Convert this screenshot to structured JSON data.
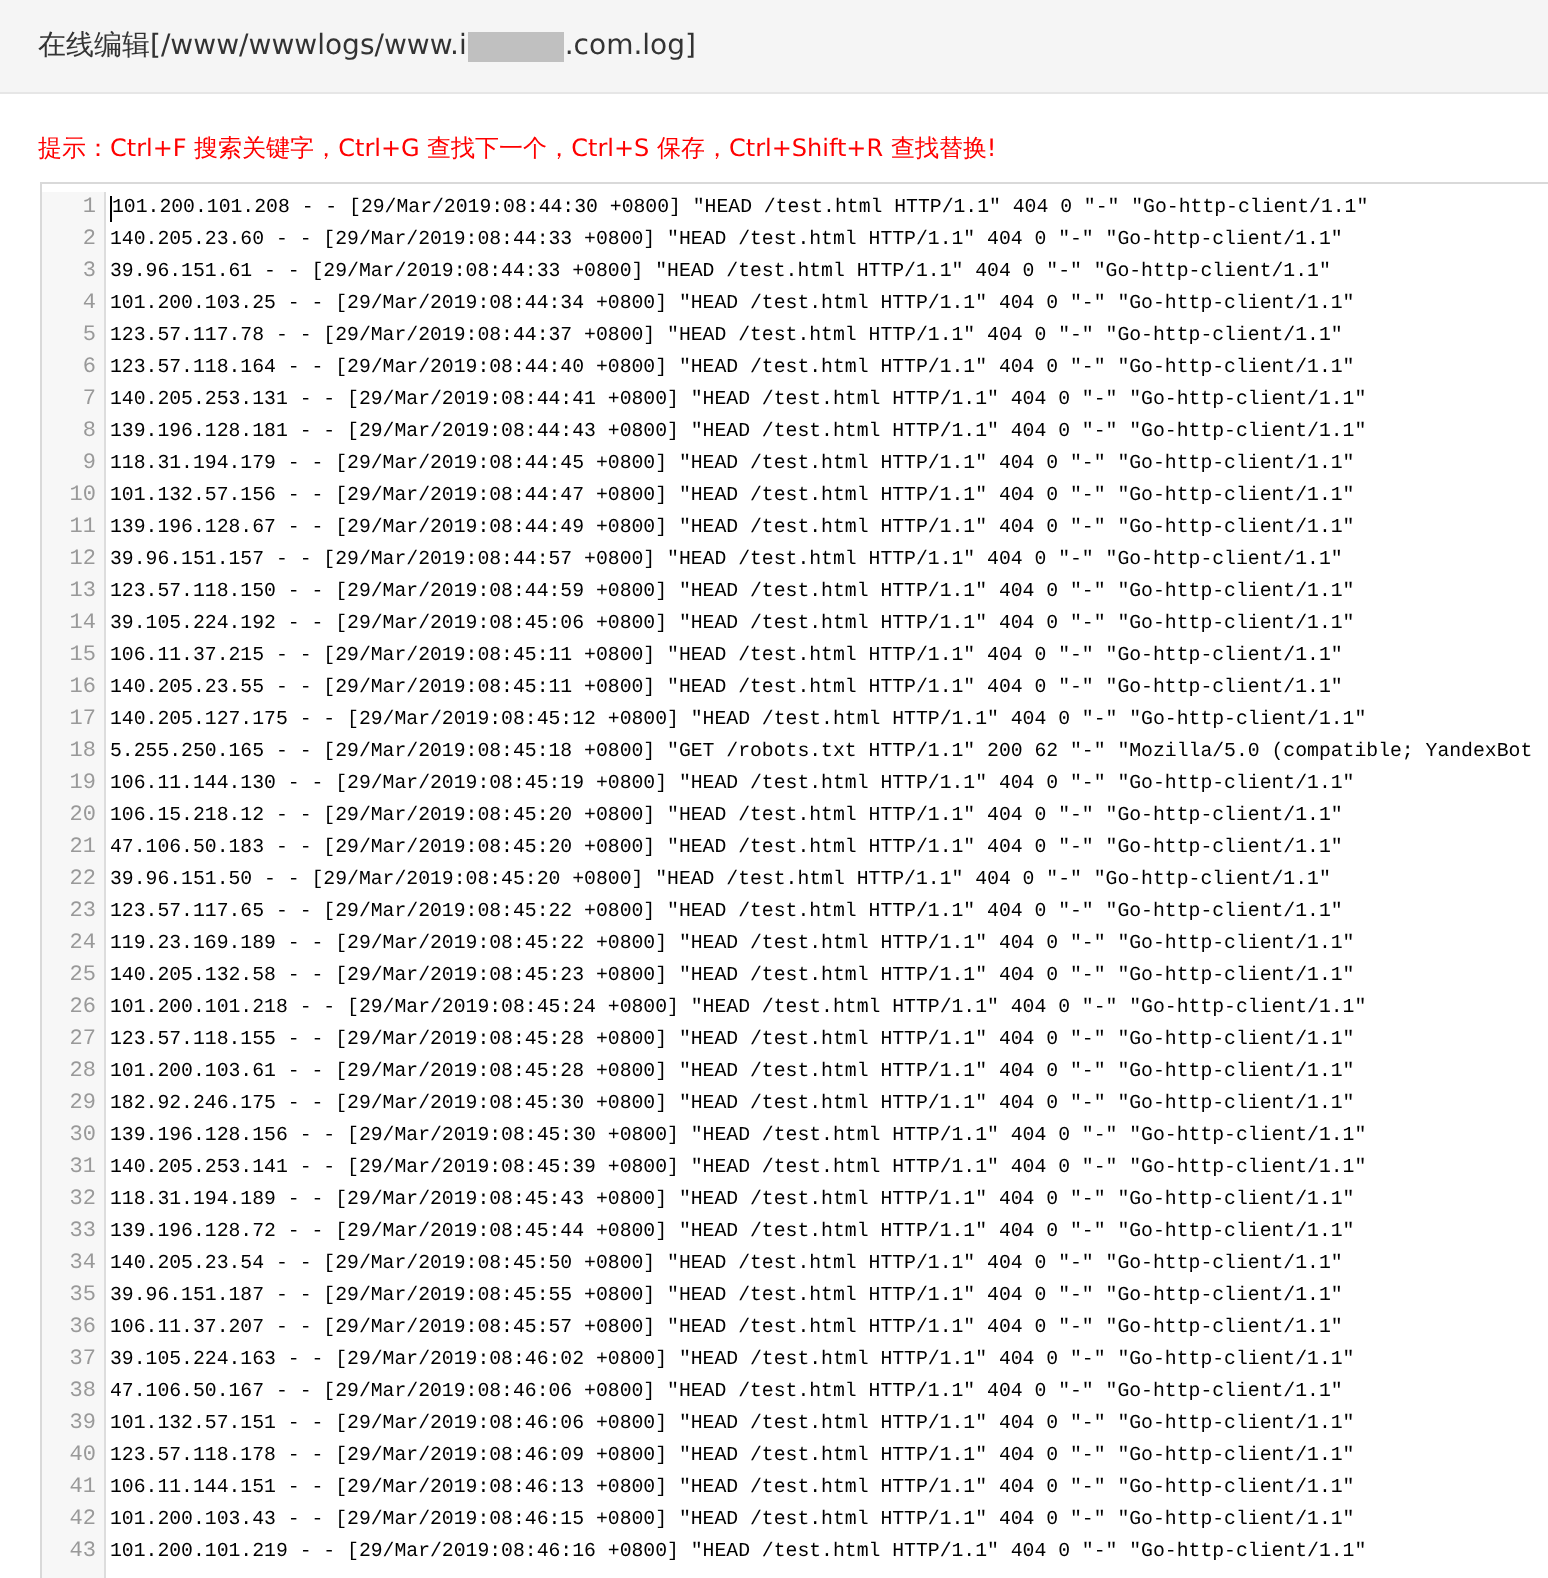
{
  "header": {
    "title_start": "在线编辑[/www/wwwlogs/www.i",
    "title_end": ".com.log]"
  },
  "hint": "提示：Ctrl+F 搜索关键字，Ctrl+G 查找下一个，Ctrl+S 保存，Ctrl+Shift+R 查找替换!",
  "editor": {
    "lines": [
      {
        "number": "1",
        "text": "101.200.101.208 - - [29/Mar/2019:08:44:30 +0800] \"HEAD /test.html HTTP/1.1\" 404 0 \"-\" \"Go-http-client/1.1\""
      },
      {
        "number": "2",
        "text": "140.205.23.60 - - [29/Mar/2019:08:44:33 +0800] \"HEAD /test.html HTTP/1.1\" 404 0 \"-\" \"Go-http-client/1.1\""
      },
      {
        "number": "3",
        "text": "39.96.151.61 - - [29/Mar/2019:08:44:33 +0800] \"HEAD /test.html HTTP/1.1\" 404 0 \"-\" \"Go-http-client/1.1\""
      },
      {
        "number": "4",
        "text": "101.200.103.25 - - [29/Mar/2019:08:44:34 +0800] \"HEAD /test.html HTTP/1.1\" 404 0 \"-\" \"Go-http-client/1.1\""
      },
      {
        "number": "5",
        "text": "123.57.117.78 - - [29/Mar/2019:08:44:37 +0800] \"HEAD /test.html HTTP/1.1\" 404 0 \"-\" \"Go-http-client/1.1\""
      },
      {
        "number": "6",
        "text": "123.57.118.164 - - [29/Mar/2019:08:44:40 +0800] \"HEAD /test.html HTTP/1.1\" 404 0 \"-\" \"Go-http-client/1.1\""
      },
      {
        "number": "7",
        "text": "140.205.253.131 - - [29/Mar/2019:08:44:41 +0800] \"HEAD /test.html HTTP/1.1\" 404 0 \"-\" \"Go-http-client/1.1\""
      },
      {
        "number": "8",
        "text": "139.196.128.181 - - [29/Mar/2019:08:44:43 +0800] \"HEAD /test.html HTTP/1.1\" 404 0 \"-\" \"Go-http-client/1.1\""
      },
      {
        "number": "9",
        "text": "118.31.194.179 - - [29/Mar/2019:08:44:45 +0800] \"HEAD /test.html HTTP/1.1\" 404 0 \"-\" \"Go-http-client/1.1\""
      },
      {
        "number": "10",
        "text": "101.132.57.156 - - [29/Mar/2019:08:44:47 +0800] \"HEAD /test.html HTTP/1.1\" 404 0 \"-\" \"Go-http-client/1.1\""
      },
      {
        "number": "11",
        "text": "139.196.128.67 - - [29/Mar/2019:08:44:49 +0800] \"HEAD /test.html HTTP/1.1\" 404 0 \"-\" \"Go-http-client/1.1\""
      },
      {
        "number": "12",
        "text": "39.96.151.157 - - [29/Mar/2019:08:44:57 +0800] \"HEAD /test.html HTTP/1.1\" 404 0 \"-\" \"Go-http-client/1.1\""
      },
      {
        "number": "13",
        "text": "123.57.118.150 - - [29/Mar/2019:08:44:59 +0800] \"HEAD /test.html HTTP/1.1\" 404 0 \"-\" \"Go-http-client/1.1\""
      },
      {
        "number": "14",
        "text": "39.105.224.192 - - [29/Mar/2019:08:45:06 +0800] \"HEAD /test.html HTTP/1.1\" 404 0 \"-\" \"Go-http-client/1.1\""
      },
      {
        "number": "15",
        "text": "106.11.37.215 - - [29/Mar/2019:08:45:11 +0800] \"HEAD /test.html HTTP/1.1\" 404 0 \"-\" \"Go-http-client/1.1\""
      },
      {
        "number": "16",
        "text": "140.205.23.55 - - [29/Mar/2019:08:45:11 +0800] \"HEAD /test.html HTTP/1.1\" 404 0 \"-\" \"Go-http-client/1.1\""
      },
      {
        "number": "17",
        "text": "140.205.127.175 - - [29/Mar/2019:08:45:12 +0800] \"HEAD /test.html HTTP/1.1\" 404 0 \"-\" \"Go-http-client/1.1\""
      },
      {
        "number": "18",
        "text": "5.255.250.165 - - [29/Mar/2019:08:45:18 +0800] \"GET /robots.txt HTTP/1.1\" 200 62 \"-\" \"Mozilla/5.0 (compatible; YandexBot"
      },
      {
        "number": "19",
        "text": "106.11.144.130 - - [29/Mar/2019:08:45:19 +0800] \"HEAD /test.html HTTP/1.1\" 404 0 \"-\" \"Go-http-client/1.1\""
      },
      {
        "number": "20",
        "text": "106.15.218.12 - - [29/Mar/2019:08:45:20 +0800] \"HEAD /test.html HTTP/1.1\" 404 0 \"-\" \"Go-http-client/1.1\""
      },
      {
        "number": "21",
        "text": "47.106.50.183 - - [29/Mar/2019:08:45:20 +0800] \"HEAD /test.html HTTP/1.1\" 404 0 \"-\" \"Go-http-client/1.1\""
      },
      {
        "number": "22",
        "text": "39.96.151.50 - - [29/Mar/2019:08:45:20 +0800] \"HEAD /test.html HTTP/1.1\" 404 0 \"-\" \"Go-http-client/1.1\""
      },
      {
        "number": "23",
        "text": "123.57.117.65 - - [29/Mar/2019:08:45:22 +0800] \"HEAD /test.html HTTP/1.1\" 404 0 \"-\" \"Go-http-client/1.1\""
      },
      {
        "number": "24",
        "text": "119.23.169.189 - - [29/Mar/2019:08:45:22 +0800] \"HEAD /test.html HTTP/1.1\" 404 0 \"-\" \"Go-http-client/1.1\""
      },
      {
        "number": "25",
        "text": "140.205.132.58 - - [29/Mar/2019:08:45:23 +0800] \"HEAD /test.html HTTP/1.1\" 404 0 \"-\" \"Go-http-client/1.1\""
      },
      {
        "number": "26",
        "text": "101.200.101.218 - - [29/Mar/2019:08:45:24 +0800] \"HEAD /test.html HTTP/1.1\" 404 0 \"-\" \"Go-http-client/1.1\""
      },
      {
        "number": "27",
        "text": "123.57.118.155 - - [29/Mar/2019:08:45:28 +0800] \"HEAD /test.html HTTP/1.1\" 404 0 \"-\" \"Go-http-client/1.1\""
      },
      {
        "number": "28",
        "text": "101.200.103.61 - - [29/Mar/2019:08:45:28 +0800] \"HEAD /test.html HTTP/1.1\" 404 0 \"-\" \"Go-http-client/1.1\""
      },
      {
        "number": "29",
        "text": "182.92.246.175 - - [29/Mar/2019:08:45:30 +0800] \"HEAD /test.html HTTP/1.1\" 404 0 \"-\" \"Go-http-client/1.1\""
      },
      {
        "number": "30",
        "text": "139.196.128.156 - - [29/Mar/2019:08:45:30 +0800] \"HEAD /test.html HTTP/1.1\" 404 0 \"-\" \"Go-http-client/1.1\""
      },
      {
        "number": "31",
        "text": "140.205.253.141 - - [29/Mar/2019:08:45:39 +0800] \"HEAD /test.html HTTP/1.1\" 404 0 \"-\" \"Go-http-client/1.1\""
      },
      {
        "number": "32",
        "text": "118.31.194.189 - - [29/Mar/2019:08:45:43 +0800] \"HEAD /test.html HTTP/1.1\" 404 0 \"-\" \"Go-http-client/1.1\""
      },
      {
        "number": "33",
        "text": "139.196.128.72 - - [29/Mar/2019:08:45:44 +0800] \"HEAD /test.html HTTP/1.1\" 404 0 \"-\" \"Go-http-client/1.1\""
      },
      {
        "number": "34",
        "text": "140.205.23.54 - - [29/Mar/2019:08:45:50 +0800] \"HEAD /test.html HTTP/1.1\" 404 0 \"-\" \"Go-http-client/1.1\""
      },
      {
        "number": "35",
        "text": "39.96.151.187 - - [29/Mar/2019:08:45:55 +0800] \"HEAD /test.html HTTP/1.1\" 404 0 \"-\" \"Go-http-client/1.1\""
      },
      {
        "number": "36",
        "text": "106.11.37.207 - - [29/Mar/2019:08:45:57 +0800] \"HEAD /test.html HTTP/1.1\" 404 0 \"-\" \"Go-http-client/1.1\""
      },
      {
        "number": "37",
        "text": "39.105.224.163 - - [29/Mar/2019:08:46:02 +0800] \"HEAD /test.html HTTP/1.1\" 404 0 \"-\" \"Go-http-client/1.1\""
      },
      {
        "number": "38",
        "text": "47.106.50.167 - - [29/Mar/2019:08:46:06 +0800] \"HEAD /test.html HTTP/1.1\" 404 0 \"-\" \"Go-http-client/1.1\""
      },
      {
        "number": "39",
        "text": "101.132.57.151 - - [29/Mar/2019:08:46:06 +0800] \"HEAD /test.html HTTP/1.1\" 404 0 \"-\" \"Go-http-client/1.1\""
      },
      {
        "number": "40",
        "text": "123.57.118.178 - - [29/Mar/2019:08:46:09 +0800] \"HEAD /test.html HTTP/1.1\" 404 0 \"-\" \"Go-http-client/1.1\""
      },
      {
        "number": "41",
        "text": "106.11.144.151 - - [29/Mar/2019:08:46:13 +0800] \"HEAD /test.html HTTP/1.1\" 404 0 \"-\" \"Go-http-client/1.1\""
      },
      {
        "number": "42",
        "text": "101.200.103.43 - - [29/Mar/2019:08:46:15 +0800] \"HEAD /test.html HTTP/1.1\" 404 0 \"-\" \"Go-http-client/1.1\""
      },
      {
        "number": "43",
        "text": "101.200.101.219 - - [29/Mar/2019:08:46:16 +0800] \"HEAD /test.html HTTP/1.1\" 404 0 \"-\" \"Go-http-client/1.1\""
      }
    ]
  }
}
